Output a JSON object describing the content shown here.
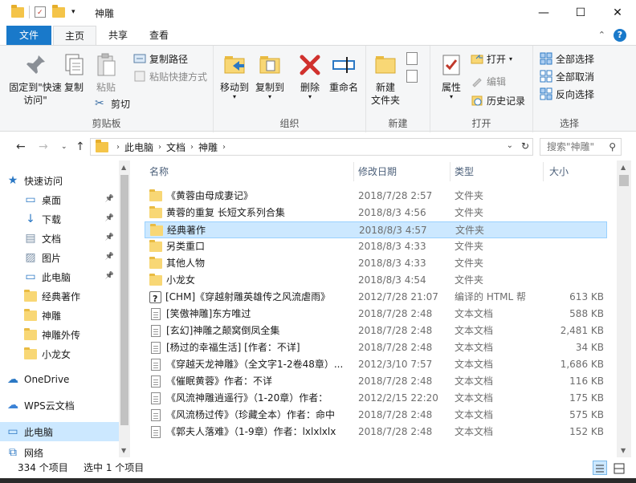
{
  "window": {
    "title": "神雕"
  },
  "tabs": {
    "file": "文件",
    "home": "主页",
    "share": "共享",
    "view": "查看",
    "help": "?"
  },
  "ribbon": {
    "clipboard": {
      "pin_quick": "固定到\"快速访问\"",
      "copy": "复制",
      "paste": "粘贴",
      "copy_path": "复制路径",
      "paste_shortcut": "粘贴快捷方式",
      "cut": "剪切",
      "label": "剪贴板"
    },
    "organize": {
      "move_to": "移动到",
      "copy_to": "复制到",
      "delete": "删除",
      "rename": "重命名",
      "label": "组织"
    },
    "new": {
      "new_folder": "新建\n文件夹",
      "label": "新建"
    },
    "open": {
      "properties": "属性",
      "open": "打开",
      "edit": "编辑",
      "history": "历史记录",
      "label": "打开"
    },
    "select": {
      "select_all": "全部选择",
      "select_none": "全部取消",
      "invert": "反向选择",
      "label": "选择"
    }
  },
  "address": {
    "crumbs": [
      "此电脑",
      "文档",
      "神雕"
    ],
    "search_placeholder": "搜索\"神雕\""
  },
  "nav": {
    "items": [
      {
        "label": "快速访问",
        "icon": "star-icon",
        "pinned": false
      },
      {
        "label": "桌面",
        "icon": "desktop-icon",
        "pinned": true
      },
      {
        "label": "下载",
        "icon": "download-icon",
        "pinned": true
      },
      {
        "label": "文档",
        "icon": "document-icon",
        "pinned": true
      },
      {
        "label": "图片",
        "icon": "picture-icon",
        "pinned": true
      },
      {
        "label": "此电脑",
        "icon": "computer-icon",
        "pinned": true
      },
      {
        "label": "经典著作",
        "icon": "folder-icon",
        "pinned": false
      },
      {
        "label": "神雕",
        "icon": "folder-icon",
        "pinned": false
      },
      {
        "label": "神雕外传",
        "icon": "folder-icon",
        "pinned": false
      },
      {
        "label": "小龙女",
        "icon": "folder-icon",
        "pinned": false
      },
      {
        "label": "OneDrive",
        "icon": "cloud-icon",
        "pinned": false
      },
      {
        "label": "WPS云文档",
        "icon": "wps-cloud-icon",
        "pinned": false
      },
      {
        "label": "此电脑",
        "icon": "computer-icon",
        "pinned": false
      },
      {
        "label": "网络",
        "icon": "network-icon",
        "pinned": false
      }
    ]
  },
  "columns": {
    "name": "名称",
    "date": "修改日期",
    "type": "类型",
    "size": "大小"
  },
  "files": [
    {
      "name": "《黄蓉由母成妻记》",
      "date": "2018/7/28 2:57",
      "type": "文件夹",
      "size": "",
      "kind": "folder"
    },
    {
      "name": "黄蓉的重复 长短文系列合集",
      "date": "2018/8/3 4:56",
      "type": "文件夹",
      "size": "",
      "kind": "folder"
    },
    {
      "name": "经典著作",
      "date": "2018/8/3 4:57",
      "type": "文件夹",
      "size": "",
      "kind": "folder"
    },
    {
      "name": "另类重口",
      "date": "2018/8/3 4:33",
      "type": "文件夹",
      "size": "",
      "kind": "folder"
    },
    {
      "name": "其他人物",
      "date": "2018/8/3 4:33",
      "type": "文件夹",
      "size": "",
      "kind": "folder"
    },
    {
      "name": "小龙女",
      "date": "2018/8/3 4:54",
      "type": "文件夹",
      "size": "",
      "kind": "folder"
    },
    {
      "name": "[CHM]《穿越射雕英雄传之风流虐雨》",
      "date": "2012/7/28 21:07",
      "type": "编译的 HTML 帮",
      "size": "613 KB",
      "kind": "chm"
    },
    {
      "name": "[笑傲神雕]东方唯过",
      "date": "2018/7/28 2:48",
      "type": "文本文档",
      "size": "588 KB",
      "kind": "doc"
    },
    {
      "name": "[玄幻]神雕之颠窝倒凤全集",
      "date": "2018/7/28 2:48",
      "type": "文本文档",
      "size": "2,481 KB",
      "kind": "doc"
    },
    {
      "name": "[杨过的幸福生活] [作者：不详]",
      "date": "2018/7/28 2:48",
      "type": "文本文档",
      "size": "34 KB",
      "kind": "doc"
    },
    {
      "name": "《穿越天龙神雕》（全文字1-2卷48章）...",
      "date": "2012/3/10 7:57",
      "type": "文本文档",
      "size": "1,686 KB",
      "kind": "doc"
    },
    {
      "name": "《催眠黄蓉》作者：不详",
      "date": "2018/7/28 2:48",
      "type": "文本文档",
      "size": "116 KB",
      "kind": "doc"
    },
    {
      "name": "《风流神雕逍遥行》（1-20章）作者：",
      "date": "2012/2/15 22:20",
      "type": "文本文档",
      "size": "175 KB",
      "kind": "doc"
    },
    {
      "name": "《风流杨过传》（珍藏全本）作者：命中",
      "date": "2018/7/28 2:48",
      "type": "文本文档",
      "size": "575 KB",
      "kind": "doc"
    },
    {
      "name": "《郭夫人落难》（1-9章）作者：lxlxlxlx",
      "date": "2018/7/28 2:48",
      "type": "文本文档",
      "size": "152 KB",
      "kind": "doc"
    }
  ],
  "selected_index": 2,
  "status": {
    "count": "334 个项目",
    "selected": "选中 1 个项目"
  }
}
